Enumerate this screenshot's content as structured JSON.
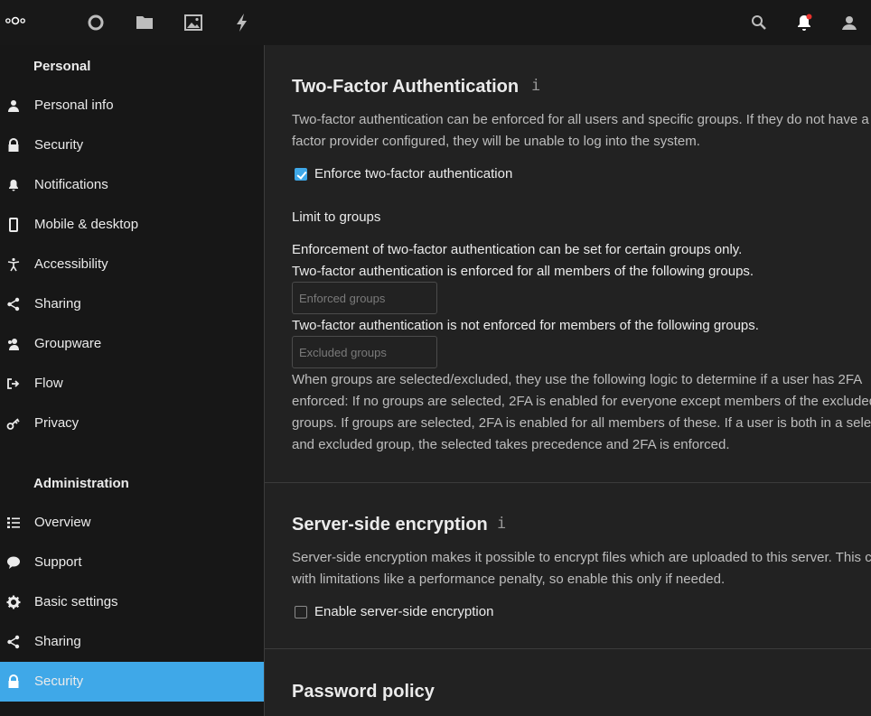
{
  "header": {
    "icons": [
      "nextcloud-logo",
      "dashboard-icon",
      "files-icon",
      "photos-icon",
      "activity-icon",
      "search-icon",
      "notifications-icon",
      "user-icon"
    ],
    "notification_badge_color": "#e9322d"
  },
  "sidebar": {
    "personal_title": "Personal",
    "personal_items": [
      {
        "label": "Personal info",
        "icon": "user-icon"
      },
      {
        "label": "Security",
        "icon": "lock-icon"
      },
      {
        "label": "Notifications",
        "icon": "bell-icon"
      },
      {
        "label": "Mobile & desktop",
        "icon": "phone-icon"
      },
      {
        "label": "Accessibility",
        "icon": "accessibility-icon"
      },
      {
        "label": "Sharing",
        "icon": "share-icon"
      },
      {
        "label": "Groupware",
        "icon": "groupware-icon"
      },
      {
        "label": "Flow",
        "icon": "flow-icon"
      },
      {
        "label": "Privacy",
        "icon": "key-icon"
      }
    ],
    "admin_title": "Administration",
    "admin_items": [
      {
        "label": "Overview",
        "icon": "list-icon"
      },
      {
        "label": "Support",
        "icon": "support-icon"
      },
      {
        "label": "Basic settings",
        "icon": "gear-icon"
      },
      {
        "label": "Sharing",
        "icon": "share-icon"
      },
      {
        "label": "Security",
        "icon": "lock-icon",
        "active": true
      }
    ],
    "active_color": "#3fa8e8"
  },
  "twofa": {
    "title": "Two-Factor Authentication",
    "info": "i",
    "desc_line1": "Two-factor authentication can be enforced for all users and specific groups. If they do not have a",
    "desc_line2": "factor provider configured, they will be unable to log into the system.",
    "enforce_label": "Enforce two-factor authentication",
    "enforce_checked": true,
    "limit_title": "Limit to groups",
    "limit_line1": "Enforcement of two-factor authentication can be set for certain groups only.",
    "limit_line2": "Two-factor authentication is enforced for all members of the following groups.",
    "enforced_placeholder": "Enforced groups",
    "excluded_line": "Two-factor authentication is not enforced for members of the following groups.",
    "excluded_placeholder": "Excluded groups",
    "logic_line1": "When groups are selected/excluded, they use the following logic to determine if a user has 2FA",
    "logic_line2": "enforced: If no groups are selected, 2FA is enabled for everyone except members of the excluded",
    "logic_line3": "groups. If groups are selected, 2FA is enabled for all members of these. If a user is both in a select",
    "logic_line4": "and excluded group, the selected takes precedence and 2FA is enforced."
  },
  "encryption": {
    "title": "Server-side encryption",
    "info": "i",
    "desc_line1": "Server-side encryption makes it possible to encrypt files which are uploaded to this server. This co",
    "desc_line2": "with limitations like a performance penalty, so enable this only if needed.",
    "enable_label": "Enable server-side encryption",
    "enable_checked": false
  },
  "password_policy": {
    "title": "Password policy"
  }
}
